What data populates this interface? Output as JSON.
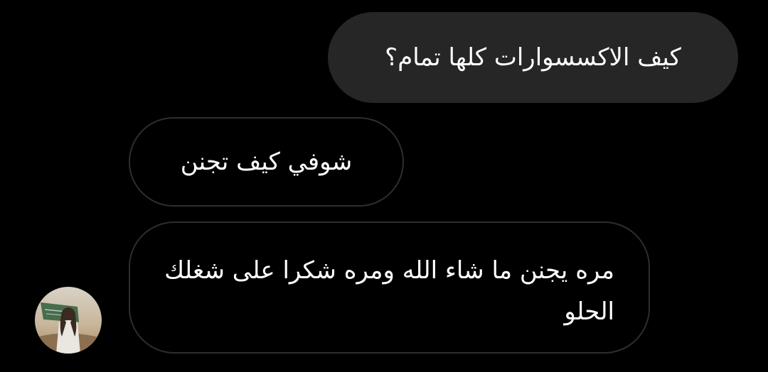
{
  "messages": [
    {
      "side": "sent",
      "text": "كيف الاكسسوارات كلها تمام؟"
    },
    {
      "side": "received",
      "text": "شوفي كيف تجنن"
    },
    {
      "side": "received",
      "text": "مره يجنن ما شاء الله ومره شكرا على شغلك الحلو"
    }
  ],
  "avatar": {
    "icon": "profile-photo-avatar"
  },
  "colors": {
    "background": "#000000",
    "sent_bubble": "#262626",
    "received_border": "#2e2e2e",
    "text": "#ffffff"
  }
}
